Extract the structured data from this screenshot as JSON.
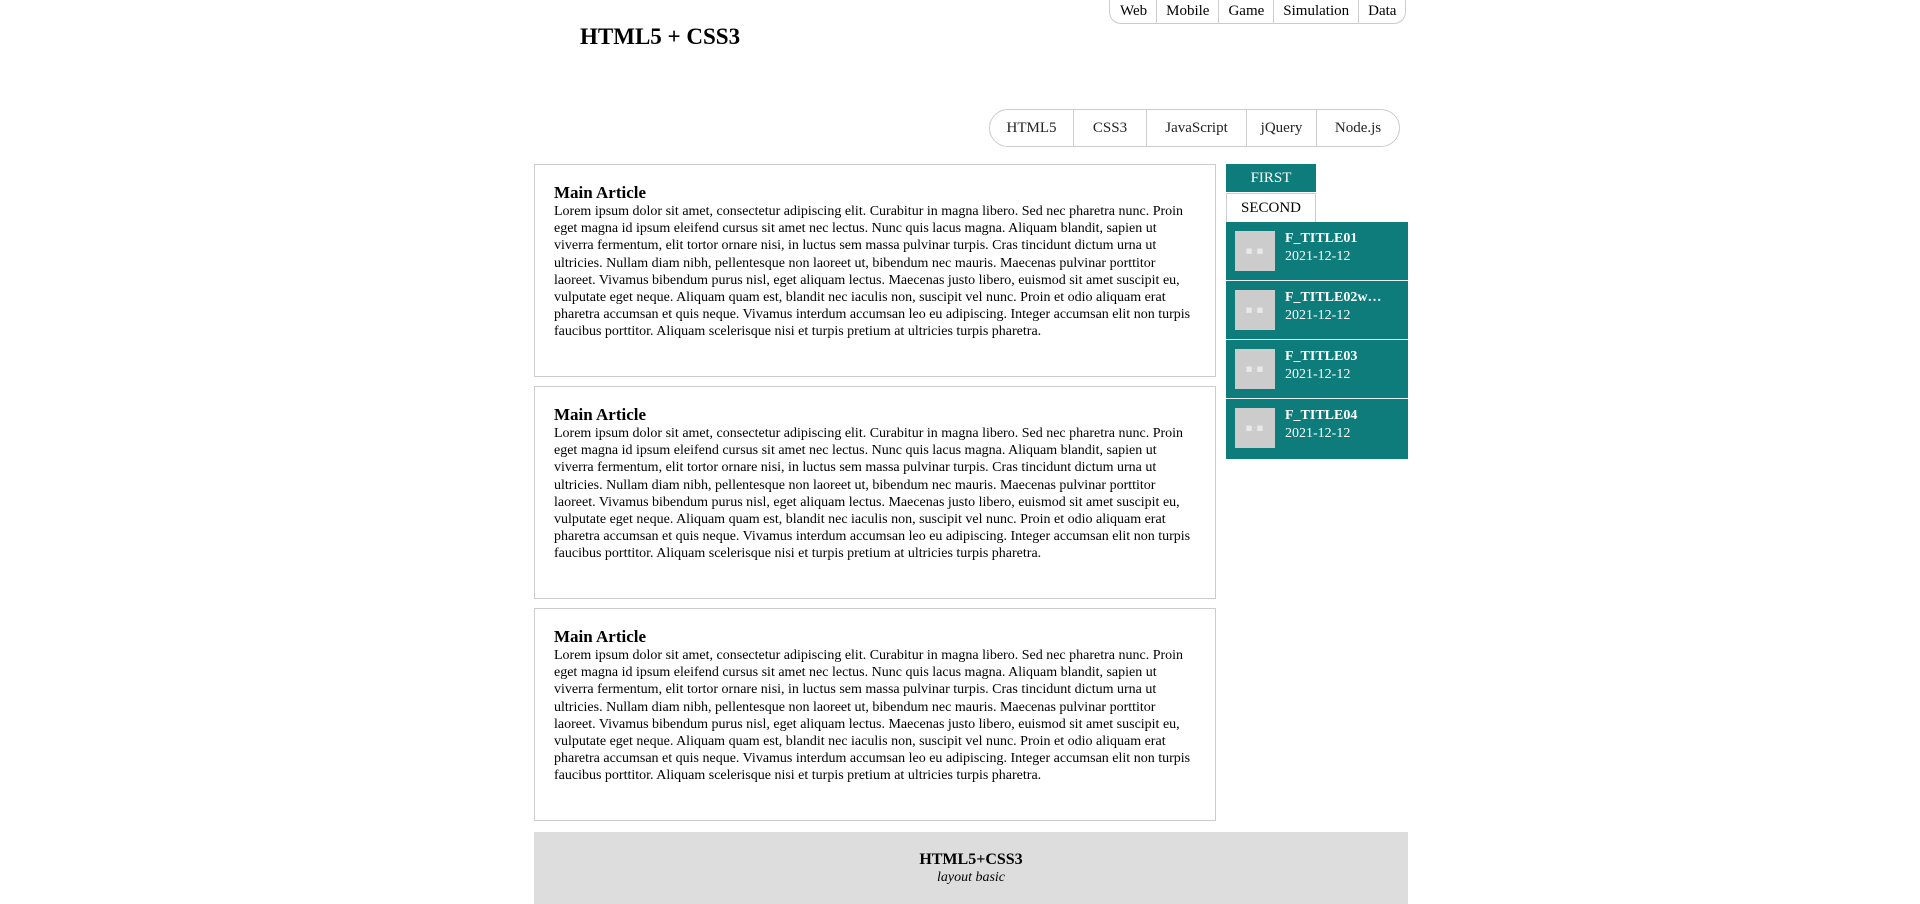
{
  "top_menu": [
    "Web",
    "Mobile",
    "Game",
    "Simulation",
    "Data"
  ],
  "site_title": "HTML5 + CSS3",
  "main_nav": [
    "HTML5",
    "CSS3",
    "JavaScript",
    "jQuery",
    "Node.js"
  ],
  "articles": [
    {
      "title": "Main Article",
      "body": "Lorem ipsum dolor sit amet, consectetur adipiscing elit. Curabitur in magna libero. Sed nec pharetra nunc. Proin eget magna id ipsum eleifend cursus sit amet nec lectus. Nunc quis lacus magna. Aliquam blandit, sapien ut viverra fermentum, elit tortor ornare nisi, in luctus sem massa pulvinar turpis. Cras tincidunt dictum urna ut ultricies. Nullam diam nibh, pellentesque non laoreet ut, bibendum nec mauris. Maecenas pulvinar porttitor laoreet. Vivamus bibendum purus nisl, eget aliquam lectus. Maecenas justo libero, euismod sit amet suscipit eu, vulputate eget neque. Aliquam quam est, blandit nec iaculis non, suscipit vel nunc. Proin et odio aliquam erat pharetra accumsan et quis neque. Vivamus interdum accumsan leo eu adipiscing. Integer accumsan elit non turpis faucibus porttitor. Aliquam scelerisque nisi et turpis pretium at ultricies turpis pharetra."
    },
    {
      "title": "Main Article",
      "body": "Lorem ipsum dolor sit amet, consectetur adipiscing elit. Curabitur in magna libero. Sed nec pharetra nunc. Proin eget magna id ipsum eleifend cursus sit amet nec lectus. Nunc quis lacus magna. Aliquam blandit, sapien ut viverra fermentum, elit tortor ornare nisi, in luctus sem massa pulvinar turpis. Cras tincidunt dictum urna ut ultricies. Nullam diam nibh, pellentesque non laoreet ut, bibendum nec mauris. Maecenas pulvinar porttitor laoreet. Vivamus bibendum purus nisl, eget aliquam lectus. Maecenas justo libero, euismod sit amet suscipit eu, vulputate eget neque. Aliquam quam est, blandit nec iaculis non, suscipit vel nunc. Proin et odio aliquam erat pharetra accumsan et quis neque. Vivamus interdum accumsan leo eu adipiscing. Integer accumsan elit non turpis faucibus porttitor. Aliquam scelerisque nisi et turpis pretium at ultricies turpis pharetra."
    },
    {
      "title": "Main Article",
      "body": "Lorem ipsum dolor sit amet, consectetur adipiscing elit. Curabitur in magna libero. Sed nec pharetra nunc. Proin eget magna id ipsum eleifend cursus sit amet nec lectus. Nunc quis lacus magna. Aliquam blandit, sapien ut viverra fermentum, elit tortor ornare nisi, in luctus sem massa pulvinar turpis. Cras tincidunt dictum urna ut ultricies. Nullam diam nibh, pellentesque non laoreet ut, bibendum nec mauris. Maecenas pulvinar porttitor laoreet. Vivamus bibendum purus nisl, eget aliquam lectus. Maecenas justo libero, euismod sit amet suscipit eu, vulputate eget neque. Aliquam quam est, blandit nec iaculis non, suscipit vel nunc. Proin et odio aliquam erat pharetra accumsan et quis neque. Vivamus interdum accumsan leo eu adipiscing. Integer accumsan elit non turpis faucibus porttitor. Aliquam scelerisque nisi et turpis pretium at ultricies turpis pharetra."
    }
  ],
  "sidebar": {
    "tabs": {
      "first": "FIRST",
      "second": "SECOND"
    },
    "items": [
      {
        "title": "F_TITLE01",
        "date": "2021-12-12"
      },
      {
        "title": "F_TITLE02w…",
        "date": "2021-12-12"
      },
      {
        "title": "F_TITLE03",
        "date": "2021-12-12"
      },
      {
        "title": "F_TITLE04",
        "date": "2021-12-12"
      }
    ],
    "thumb_placeholder": "■·■",
    "accent_color": "#0e7c7b"
  },
  "footer": {
    "title": "HTML5+CSS3",
    "subtitle": "layout basic"
  }
}
